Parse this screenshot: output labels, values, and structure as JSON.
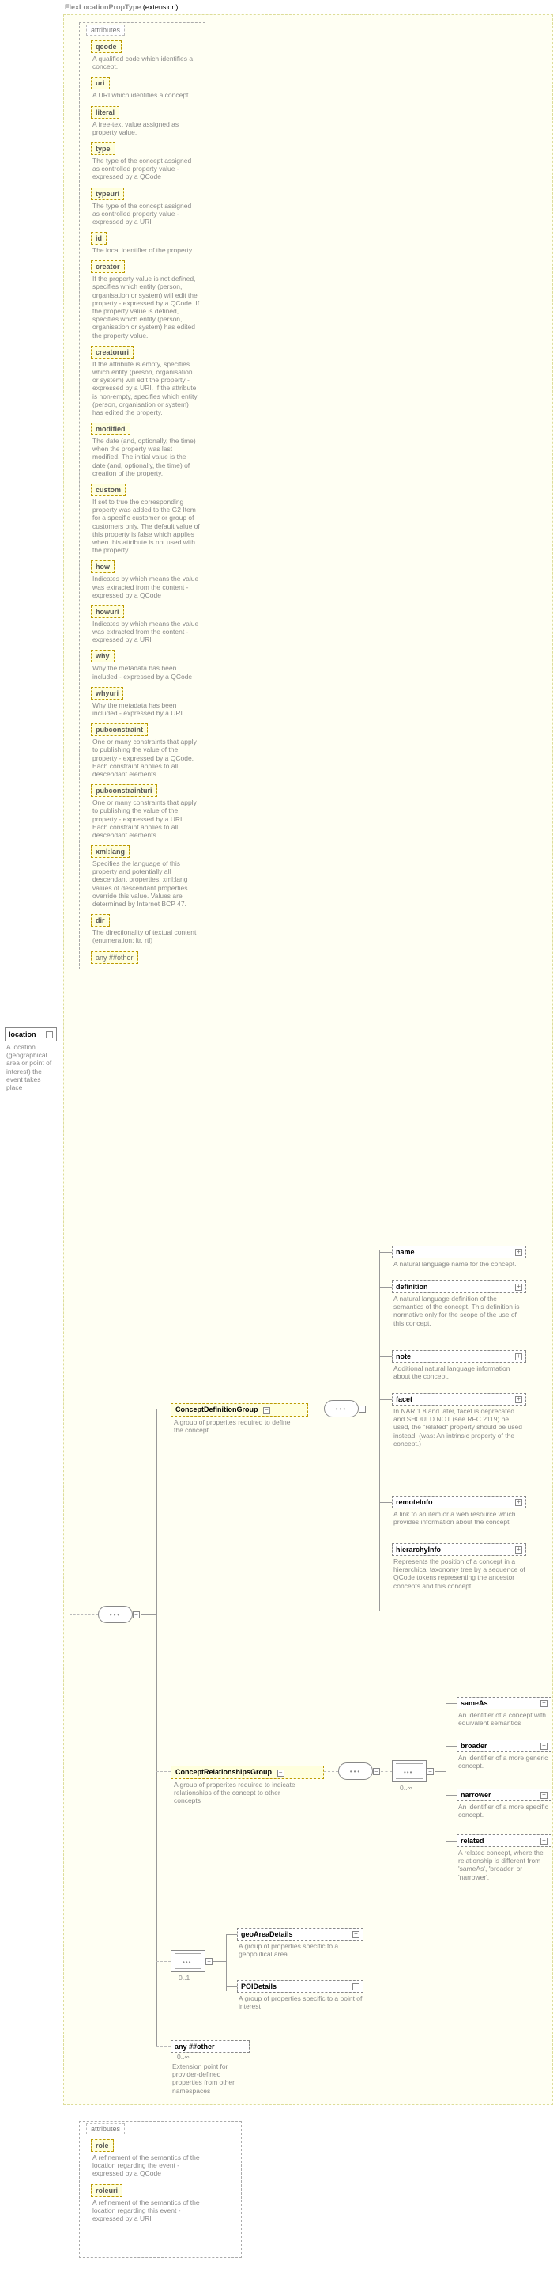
{
  "extension": {
    "label": "FlexLocationPropType",
    "suffix": " (extension)"
  },
  "root": {
    "name": "location",
    "desc": "A location (geographical area or point of interest) the event takes place"
  },
  "attrBox1Title": "attributes",
  "attrs1": [
    {
      "name": "qcode",
      "desc": "A qualified code which identifies a concept."
    },
    {
      "name": "uri",
      "desc": "A URI which identifies a concept."
    },
    {
      "name": "literal",
      "desc": "A free-text value assigned as property value."
    },
    {
      "name": "type",
      "desc": "The type of the concept assigned as controlled property value - expressed by a QCode"
    },
    {
      "name": "typeuri",
      "desc": "The type of the concept assigned as controlled property value - expressed by a URI"
    },
    {
      "name": "id",
      "desc": "The local identifier of the property."
    },
    {
      "name": "creator",
      "desc": "If the property value is not defined, specifies which entity (person, organisation or system) will edit the property - expressed by a QCode. If the property value is defined, specifies which entity (person, organisation or system) has edited the property value."
    },
    {
      "name": "creatoruri",
      "desc": "If the attribute is empty, specifies which entity (person, organisation or system) will edit the property - expressed by a URI. If the attribute is non-empty, specifies which entity (person, organisation or system) has edited the property."
    },
    {
      "name": "modified",
      "desc": "The date (and, optionally, the time) when the property was last modified. The initial value is the date (and, optionally, the time) of creation of the property."
    },
    {
      "name": "custom",
      "desc": "If set to true the corresponding property was added to the G2 Item for a specific customer or group of customers only. The default value of this property is false which applies when this attribute is not used with the property."
    },
    {
      "name": "how",
      "desc": "Indicates by which means the value was extracted from the content - expressed by a QCode"
    },
    {
      "name": "howuri",
      "desc": "Indicates by which means the value was extracted from the content - expressed by a URI"
    },
    {
      "name": "why",
      "desc": "Why the metadata has been included - expressed by a QCode"
    },
    {
      "name": "whyuri",
      "desc": "Why the metadata has been included - expressed by a URI"
    },
    {
      "name": "pubconstraint",
      "desc": "One or many constraints that apply to publishing the value of the property - expressed by a QCode. Each constraint applies to all descendant elements."
    },
    {
      "name": "pubconstrainturi",
      "desc": "One or many constraints that apply to publishing the value of the property - expressed by a URI. Each constraint applies to all descendant elements."
    },
    {
      "name": "xml:lang",
      "desc": "Specifies the language of this property and potentially all descendant properties. xml:lang values of descendant properties override this value. Values are determined by Internet BCP 47."
    },
    {
      "name": "dir",
      "desc": "The directionality of textual content (enumeration: ltr, rtl)"
    }
  ],
  "anyAttr": "any ##other",
  "groups": {
    "cdg": {
      "name": "ConceptDefinitionGroup",
      "desc": "A group of properites required to define the concept"
    },
    "crg": {
      "name": "ConceptRelationshipsGroup",
      "desc": "A group of properites required to indicate relationships of the concept to other concepts"
    }
  },
  "cdgChildren": [
    {
      "name": "name",
      "desc": "A natural language name for the concept."
    },
    {
      "name": "definition",
      "desc": "A natural language definition of the semantics of the concept. This definition is normative only for the scope of the use of this concept."
    },
    {
      "name": "note",
      "desc": "Additional natural language information about the concept."
    },
    {
      "name": "facet",
      "desc": "In NAR 1.8 and later, facet is deprecated and SHOULD NOT (see RFC 2119) be used, the \"related\" property should be used instead. (was: An intrinsic property of the concept.)"
    },
    {
      "name": "remoteInfo",
      "desc": "A link to an item or a web resource which provides information about the concept"
    },
    {
      "name": "hierarchyInfo",
      "desc": "Represents the position of a concept in a hierarchical taxonomy tree by a sequence of QCode tokens representing the ancestor concepts and this concept"
    }
  ],
  "crgChildren": [
    {
      "name": "sameAs",
      "desc": "An identifier of a concept with equivalent semantics"
    },
    {
      "name": "broader",
      "desc": "An identifier of a more generic concept."
    },
    {
      "name": "narrower",
      "desc": "An identifier of a more specific concept."
    },
    {
      "name": "related",
      "desc": "A related concept, where the relationship is different from 'sameAs', 'broader' or 'narrower'."
    }
  ],
  "choiceChildren": [
    {
      "name": "geoAreaDetails",
      "desc": "A group of properties specific to a geopolitical area"
    },
    {
      "name": "POIDetails",
      "desc": "A group of properties specific to a point of interest"
    }
  ],
  "anyOther": {
    "name": "any ##other",
    "occ": "0..∞",
    "desc": "Extension point for provider-defined properties from other namespaces"
  },
  "attrBox2Title": "attributes",
  "attrs2": [
    {
      "name": "role",
      "desc": "A refinement of the semantics of the location regarding the event - expressed by a QCode"
    },
    {
      "name": "roleuri",
      "desc": "A refinement of the semantics of the location regarding this event - expressed by a URI"
    }
  ]
}
